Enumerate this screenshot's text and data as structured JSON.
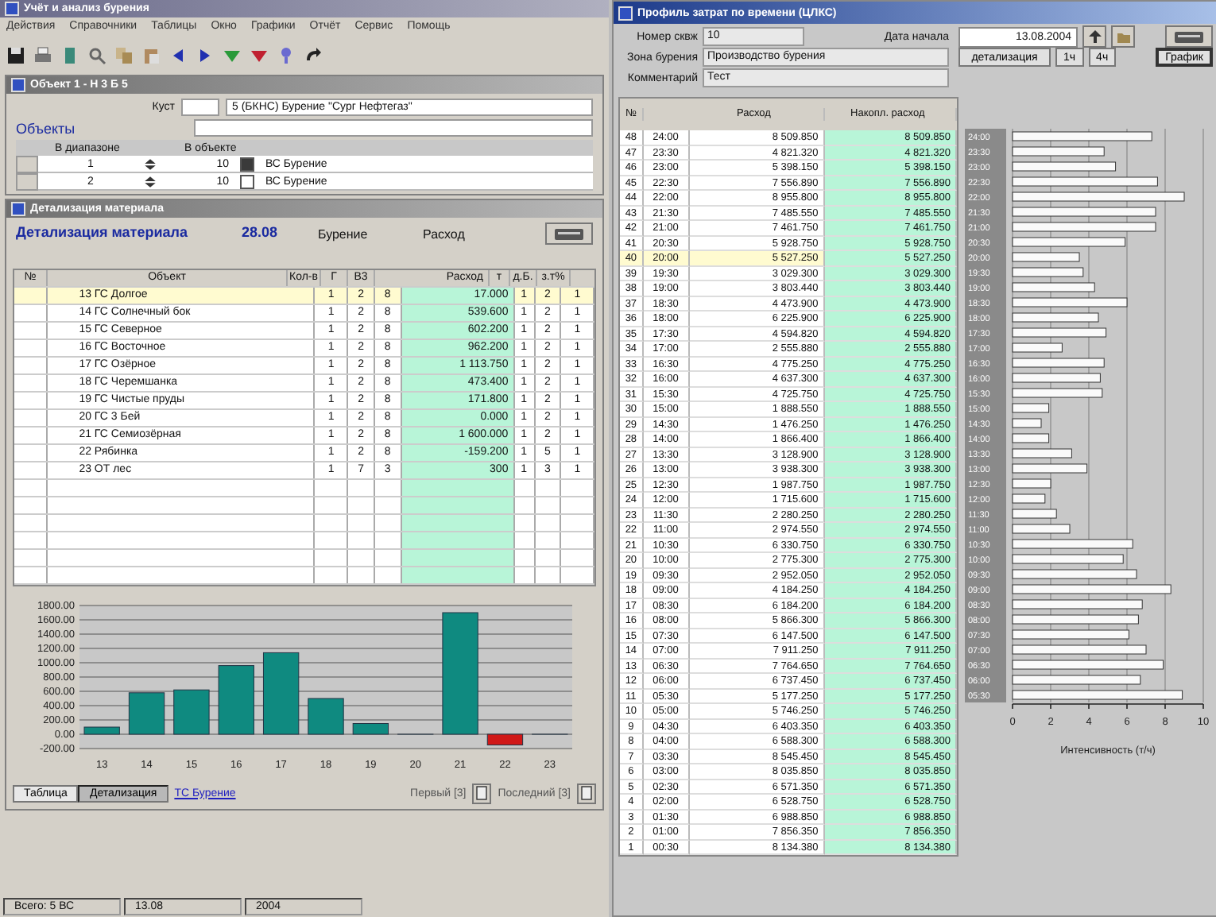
{
  "app": {
    "title": "Учёт и анализ бурения",
    "menu": [
      "Действия",
      "Справочники",
      "Таблицы",
      "Окно",
      "Графики",
      "Отчёт",
      "Сервис",
      "Помощь"
    ]
  },
  "object_window": {
    "title": "Объект 1 - Н 3 Б 5",
    "kust_label": "Куст",
    "kust_value": "5 (БКНС) Бурение \"Сург Нефтегаз\"",
    "objects_label": "Объекты",
    "col_range": "В диапазоне",
    "col_object": "В объекте",
    "rows": [
      {
        "range": "1",
        "count": "10",
        "name": "ВС Бурение",
        "checked": true
      },
      {
        "range": "2",
        "count": "10",
        "name": "ВС Бурение",
        "checked": false
      }
    ]
  },
  "detail_window": {
    "title": "Детализация материала",
    "heading": "Детализация материала",
    "date": "28.08",
    "group_drill": "Бурение",
    "group_flow": "Расход",
    "columns": [
      "№",
      "Объект",
      "Кол-в",
      "Г",
      "В3",
      "Расход",
      "т",
      "д.Б.",
      "з.т%"
    ],
    "rows": [
      {
        "num": "13",
        "name": "ГС Долгое",
        "qty": "1",
        "g": "2",
        "b": "8",
        "flow": "17.000",
        "t": "1",
        "c1": "2",
        "c2": "1",
        "selected": true
      },
      {
        "num": "14",
        "name": "ГС Солнечный бок",
        "qty": "1",
        "g": "2",
        "b": "8",
        "flow": "539.600",
        "t": "1",
        "c1": "2",
        "c2": "1",
        "selected": false
      },
      {
        "num": "15",
        "name": "ГС Северное",
        "qty": "1",
        "g": "2",
        "b": "8",
        "flow": "602.200",
        "t": "1",
        "c1": "2",
        "c2": "1",
        "selected": false
      },
      {
        "num": "16",
        "name": "ГС Восточное",
        "qty": "1",
        "g": "2",
        "b": "8",
        "flow": "962.200",
        "t": "1",
        "c1": "2",
        "c2": "1",
        "selected": false
      },
      {
        "num": "17",
        "name": "ГС Озёрное",
        "qty": "1",
        "g": "2",
        "b": "8",
        "flow": "1 113.750",
        "t": "1",
        "c1": "2",
        "c2": "1",
        "selected": false
      },
      {
        "num": "18",
        "name": "ГС Черемшанка",
        "qty": "1",
        "g": "2",
        "b": "8",
        "flow": "473.400",
        "t": "1",
        "c1": "2",
        "c2": "1",
        "selected": false
      },
      {
        "num": "19",
        "name": "ГС Чистые пруды",
        "qty": "1",
        "g": "2",
        "b": "8",
        "flow": "171.800",
        "t": "1",
        "c1": "2",
        "c2": "1",
        "selected": false
      },
      {
        "num": "20",
        "name": "ГС 3 Бей",
        "qty": "1",
        "g": "2",
        "b": "8",
        "flow": "0.000",
        "t": "1",
        "c1": "2",
        "c2": "1",
        "selected": false
      },
      {
        "num": "21",
        "name": "ГС Семиозёрная",
        "qty": "1",
        "g": "2",
        "b": "8",
        "flow": "1 600.000",
        "t": "1",
        "c1": "2",
        "c2": "1",
        "selected": false
      },
      {
        "num": "22",
        "name": "Рябинка",
        "qty": "1",
        "g": "2",
        "b": "8",
        "flow": "-159.200",
        "t": "1",
        "c1": "5",
        "c2": "1",
        "selected": false
      },
      {
        "num": "23",
        "name": "ОТ лес",
        "qty": "1",
        "g": "7",
        "b": "3",
        "flow": "300",
        "t": "1",
        "c1": "3",
        "c2": "1",
        "selected": false
      }
    ],
    "chart_data": {
      "type": "bar",
      "categories": [
        "13",
        "14",
        "15",
        "16",
        "17",
        "18",
        "19",
        "20",
        "21",
        "22",
        "23"
      ],
      "values": [
        100,
        580,
        620,
        960,
        1140,
        500,
        150,
        0,
        1700,
        -150,
        0
      ],
      "grid": true,
      "ylim": [
        -200,
        1800
      ],
      "yticks": [
        {
          "value": 1800,
          "label": "1800.00"
        },
        {
          "value": 1600,
          "label": "1600.00"
        },
        {
          "value": 1400,
          "label": "1400.00"
        },
        {
          "value": 1200,
          "label": "1200.00"
        },
        {
          "value": 1000,
          "label": "1000.00"
        },
        {
          "value": 800,
          "label": "800.00"
        },
        {
          "value": 600,
          "label": "600.00"
        },
        {
          "value": 400,
          "label": "400.00"
        },
        {
          "value": 200,
          "label": "200.00"
        },
        {
          "value": 0,
          "label": "0.00"
        },
        {
          "value": -200,
          "label": "-200.00"
        }
      ]
    },
    "tabs": [
      {
        "label": "Таблица",
        "selected": false
      },
      {
        "label": "Детализация",
        "selected": true
      }
    ],
    "link": "ТС Бурение",
    "first_label": "Первый [3]",
    "last_label": "Последний [3]"
  },
  "profile_window": {
    "title": "Профиль затрат по времени (ЦЛКС)",
    "well_label": "Номер сквж",
    "well_value": "10",
    "date_label": "Дата начала",
    "date_value": "13.08.2004",
    "zone_label": "Зона бурения",
    "zone_value": "Производство бурения",
    "comment_label": "Комментарий",
    "comment_value": "Тест",
    "buttons": [
      "детализация",
      "1ч",
      "4ч",
      "График"
    ],
    "columns": [
      "№",
      "Расход",
      "Накопл. расход"
    ],
    "rows": [
      {
        "num": "48",
        "time": "24:00",
        "flow": "8 509.850",
        "total": "8 509.850",
        "selected": false
      },
      {
        "num": "47",
        "time": "23:30",
        "flow": "4 821.320",
        "total": "4 821.320",
        "selected": false
      },
      {
        "num": "46",
        "time": "23:00",
        "flow": "5 398.150",
        "total": "5 398.150",
        "selected": false
      },
      {
        "num": "45",
        "time": "22:30",
        "flow": "7 556.890",
        "total": "7 556.890",
        "selected": false
      },
      {
        "num": "44",
        "time": "22:00",
        "flow": "8 955.800",
        "total": "8 955.800",
        "selected": false
      },
      {
        "num": "43",
        "time": "21:30",
        "flow": "7 485.550",
        "total": "7 485.550",
        "selected": false
      },
      {
        "num": "42",
        "time": "21:00",
        "flow": "7 461.750",
        "total": "7 461.750",
        "selected": false
      },
      {
        "num": "41",
        "time": "20:30",
        "flow": "5 928.750",
        "total": "5 928.750",
        "selected": false
      },
      {
        "num": "40",
        "time": "20:00",
        "flow": "5 527.250",
        "total": "5 527.250",
        "selected": true
      },
      {
        "num": "39",
        "time": "19:30",
        "flow": "3 029.300",
        "total": "3 029.300",
        "selected": false
      },
      {
        "num": "38",
        "time": "19:00",
        "flow": "3 803.440",
        "total": "3 803.440",
        "selected": false
      },
      {
        "num": "37",
        "time": "18:30",
        "flow": "4 473.900",
        "total": "4 473.900",
        "selected": false
      },
      {
        "num": "36",
        "time": "18:00",
        "flow": "6 225.900",
        "total": "6 225.900",
        "selected": false
      },
      {
        "num": "35",
        "time": "17:30",
        "flow": "4 594.820",
        "total": "4 594.820",
        "selected": false
      },
      {
        "num": "34",
        "time": "17:00",
        "flow": "2 555.880",
        "total": "2 555.880",
        "selected": false
      },
      {
        "num": "33",
        "time": "16:30",
        "flow": "4 775.250",
        "total": "4 775.250",
        "selected": false
      },
      {
        "num": "32",
        "time": "16:00",
        "flow": "4 637.300",
        "total": "4 637.300",
        "selected": false
      },
      {
        "num": "31",
        "time": "15:30",
        "flow": "4 725.750",
        "total": "4 725.750",
        "selected": false
      },
      {
        "num": "30",
        "time": "15:00",
        "flow": "1 888.550",
        "total": "1 888.550",
        "selected": false
      },
      {
        "num": "29",
        "time": "14:30",
        "flow": "1 476.250",
        "total": "1 476.250",
        "selected": false
      },
      {
        "num": "28",
        "time": "14:00",
        "flow": "1 866.400",
        "total": "1 866.400",
        "selected": false
      },
      {
        "num": "27",
        "time": "13:30",
        "flow": "3 128.900",
        "total": "3 128.900",
        "selected": false
      },
      {
        "num": "26",
        "time": "13:00",
        "flow": "3 938.300",
        "total": "3 938.300",
        "selected": false
      },
      {
        "num": "25",
        "time": "12:30",
        "flow": "1 987.750",
        "total": "1 987.750",
        "selected": false
      },
      {
        "num": "24",
        "time": "12:00",
        "flow": "1 715.600",
        "total": "1 715.600",
        "selected": false
      },
      {
        "num": "23",
        "time": "11:30",
        "flow": "2 280.250",
        "total": "2 280.250",
        "selected": false
      },
      {
        "num": "22",
        "time": "11:00",
        "flow": "2 974.550",
        "total": "2 974.550",
        "selected": false
      },
      {
        "num": "21",
        "time": "10:30",
        "flow": "6 330.750",
        "total": "6 330.750",
        "selected": false
      },
      {
        "num": "20",
        "time": "10:00",
        "flow": "2 775.300",
        "total": "2 775.300",
        "selected": false
      },
      {
        "num": "19",
        "time": "09:30",
        "flow": "2 952.050",
        "total": "2 952.050",
        "selected": false
      },
      {
        "num": "18",
        "time": "09:00",
        "flow": "4 184.250",
        "total": "4 184.250",
        "selected": false
      },
      {
        "num": "17",
        "time": "08:30",
        "flow": "6 184.200",
        "total": "6 184.200",
        "selected": false
      },
      {
        "num": "16",
        "time": "08:00",
        "flow": "5 866.300",
        "total": "5 866.300",
        "selected": false
      },
      {
        "num": "15",
        "time": "07:30",
        "flow": "6 147.500",
        "total": "6 147.500",
        "selected": false
      },
      {
        "num": "14",
        "time": "07:00",
        "flow": "7 911.250",
        "total": "7 911.250",
        "selected": false
      },
      {
        "num": "13",
        "time": "06:30",
        "flow": "7 764.650",
        "total": "7 764.650",
        "selected": false
      },
      {
        "num": "12",
        "time": "06:00",
        "flow": "6 737.450",
        "total": "6 737.450",
        "selected": false
      },
      {
        "num": "11",
        "time": "05:30",
        "flow": "5 177.250",
        "total": "5 177.250",
        "selected": false
      },
      {
        "num": "10",
        "time": "05:00",
        "flow": "5 746.250",
        "total": "5 746.250",
        "selected": false
      },
      {
        "num": "9",
        "time": "04:30",
        "flow": "6 403.350",
        "total": "6 403.350",
        "selected": false
      },
      {
        "num": "8",
        "time": "04:00",
        "flow": "6 588.300",
        "total": "6 588.300",
        "selected": false
      },
      {
        "num": "7",
        "time": "03:30",
        "flow": "8 545.450",
        "total": "8 545.450",
        "selected": false
      },
      {
        "num": "6",
        "time": "03:00",
        "flow": "8 035.850",
        "total": "8 035.850",
        "selected": false
      },
      {
        "num": "5",
        "time": "02:30",
        "flow": "6 571.350",
        "total": "6 571.350",
        "selected": false
      },
      {
        "num": "4",
        "time": "02:00",
        "flow": "6 528.750",
        "total": "6 528.750",
        "selected": false
      },
      {
        "num": "3",
        "time": "01:30",
        "flow": "6 988.850",
        "total": "6 988.850",
        "selected": false
      },
      {
        "num": "2",
        "time": "01:00",
        "flow": "7 856.350",
        "total": "7 856.350",
        "selected": false
      },
      {
        "num": "1",
        "time": "00:30",
        "flow": "8 134.380",
        "total": "8 134.380",
        "selected": false
      }
    ],
    "chart_data": {
      "type": "bar",
      "orientation": "horizontal",
      "xlabel": "Интенсивность (т/ч)",
      "categories": [
        "24:00",
        "23:30",
        "23:00",
        "22:30",
        "22:00",
        "21:30",
        "21:00",
        "20:30",
        "20:00",
        "19:30",
        "19:00",
        "18:30",
        "18:00",
        "17:30",
        "17:00",
        "16:30",
        "16:00",
        "15:30",
        "15:00",
        "14:30",
        "14:00",
        "13:30",
        "13:00",
        "12:30",
        "12:00",
        "11:30",
        "11:00",
        "10:30",
        "10:00",
        "09:30",
        "09:00",
        "08:30",
        "08:00",
        "07:30",
        "07:00",
        "06:30",
        "06:00",
        "05:30"
      ],
      "values": [
        7.3,
        4.8,
        5.4,
        7.6,
        9.0,
        7.5,
        7.5,
        5.9,
        3.5,
        3.7,
        4.3,
        6.0,
        4.5,
        4.9,
        2.6,
        4.8,
        4.6,
        4.7,
        1.9,
        1.5,
        1.9,
        3.1,
        3.9,
        2.0,
        1.7,
        2.3,
        3.0,
        6.3,
        5.8,
        6.5,
        8.3,
        6.8,
        6.6,
        6.1,
        7.0,
        7.9,
        6.7,
        8.9
      ],
      "xlim": [
        0,
        10
      ],
      "xticks": [
        0,
        2,
        4,
        6,
        8,
        10
      ],
      "grid": true
    }
  },
  "status_bar": [
    "Всего: 5 ВС",
    "13.08",
    "2004"
  ]
}
